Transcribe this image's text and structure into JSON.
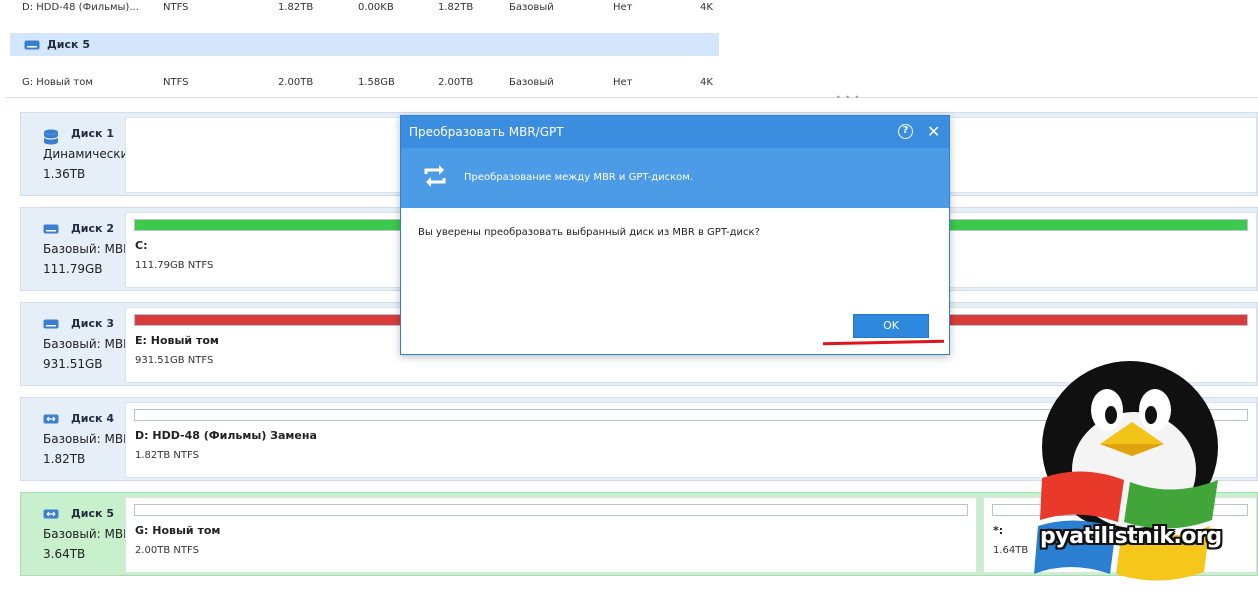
{
  "partition_table": {
    "rows": [
      {
        "name": "D: HDD-48 (Фильмы)...",
        "fs": "NTFS",
        "capacity": "1.82TB",
        "used": "0.00KB",
        "free": "1.82TB",
        "type": "Базовый",
        "status": "Нет",
        "align": "4K"
      },
      {
        "name": "G: Новый том",
        "fs": "NTFS",
        "capacity": "2.00TB",
        "used": "1.58GB",
        "free": "2.00TB",
        "type": "Базовый",
        "status": "Нет",
        "align": "4K"
      }
    ],
    "disk_header": "Диск 5"
  },
  "disks": [
    {
      "name": "Диск 1",
      "type": "Динамический:",
      "size": "1.36TB",
      "partitions": []
    },
    {
      "name": "Диск 2",
      "type": "Базовый: MBR",
      "size": "111.79GB",
      "partitions": [
        {
          "label": "C:",
          "info": "111.79GB NTFS",
          "fill_fraction": 1.0,
          "fill_color": "#3cc94e"
        }
      ]
    },
    {
      "name": "Диск 3",
      "type": "Базовый: MBR",
      "size": "931.51GB",
      "partitions": [
        {
          "label": "E: Новый том",
          "info": "931.51GB NTFS",
          "fill_fraction": 1.0,
          "fill_color": "#d93a3a"
        }
      ]
    },
    {
      "name": "Диск 4",
      "type": "Базовый: MBR",
      "size": "1.82TB",
      "partitions": [
        {
          "label": "D: HDD-48 (Фильмы) Замена",
          "info": "1.82TB NTFS",
          "fill_fraction": 0.0,
          "fill_color": "#3cc94e"
        }
      ]
    },
    {
      "name": "Диск 5",
      "type": "Базовый: MBR",
      "size": "3.64TB",
      "partitions": [
        {
          "label": "G: Новый том",
          "info": "2.00TB NTFS",
          "fill_fraction": 0.0,
          "fill_color": "#3cc94e"
        },
        {
          "label": "*:",
          "info": "1.64TB",
          "fill_fraction": 0.0,
          "fill_color": "#3cc94e"
        }
      ]
    }
  ],
  "dialog": {
    "title": "Преобразовать MBR/GPT",
    "help_glyph": "?",
    "close_glyph": "✕",
    "banner_text": "Преобразование между MBR и GPT-диском.",
    "message": "Вы уверены преобразовать выбранный диск из MBR в GPT-диск?",
    "ok_label": "OK"
  },
  "watermark": {
    "text": "pyatilistnik.org"
  },
  "colors": {
    "accent": "#3b8ddf",
    "selected_disk": "#c9f0cc",
    "disk_bg": "#e6eef8",
    "highlight_mark": "#e0141d"
  }
}
